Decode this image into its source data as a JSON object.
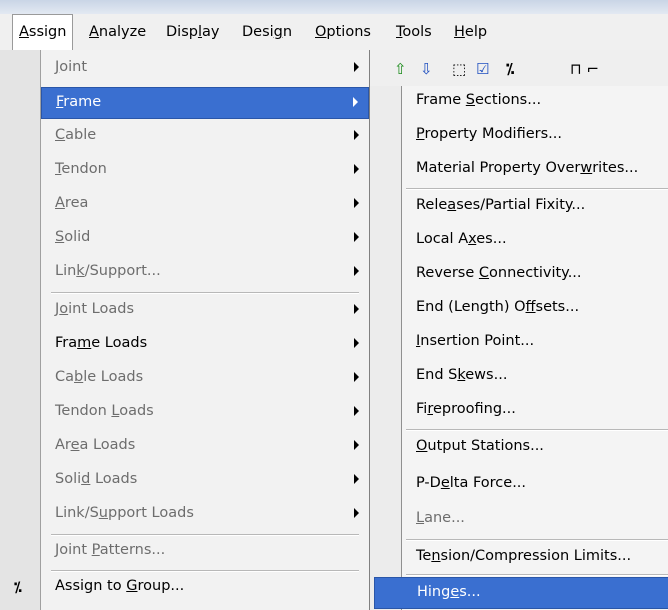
{
  "menubar": {
    "items": [
      {
        "label": "Assign",
        "mn": "A",
        "rest": "ssign"
      },
      {
        "label": "Analyze",
        "pre": "A",
        "mn": "n",
        "rest": "alyze"
      },
      {
        "label": "Display",
        "pre": "Disp",
        "mn": "l",
        "rest": "ay"
      },
      {
        "label": "Design",
        "pre": "Desi",
        "mn": "g",
        "rest": "n"
      },
      {
        "label": "Options",
        "mn": "O",
        "rest": "ptions"
      },
      {
        "label": "Tools",
        "mn": "T",
        "rest": "ools"
      },
      {
        "label": "Help",
        "mn": "H",
        "rest": "elp"
      }
    ]
  },
  "assign_menu": {
    "items": [
      {
        "label": "Joint",
        "pre": "",
        "mn": "J",
        "rest": "oint",
        "enabled": false,
        "submenu": true
      },
      {
        "label": "Frame",
        "pre": "",
        "mn": "F",
        "rest": "rame",
        "enabled": true,
        "submenu": true,
        "highlighted": true
      },
      {
        "label": "Cable",
        "pre": "",
        "mn": "C",
        "rest": "able",
        "enabled": false,
        "submenu": true
      },
      {
        "label": "Tendon",
        "pre": "",
        "mn": "T",
        "rest": "endon",
        "enabled": false,
        "submenu": true
      },
      {
        "label": "Area",
        "pre": "",
        "mn": "A",
        "rest": "rea",
        "enabled": false,
        "submenu": true
      },
      {
        "label": "Solid",
        "pre": "",
        "mn": "S",
        "rest": "olid",
        "enabled": false,
        "submenu": true
      },
      {
        "label": "Link/Support...",
        "pre": "Lin",
        "mn": "k",
        "rest": "/Support...",
        "enabled": false,
        "submenu": true
      },
      {
        "label": "Joint Loads",
        "pre": "J",
        "mn": "o",
        "rest": "int Loads",
        "enabled": false,
        "submenu": true
      },
      {
        "label": "Frame Loads",
        "pre": "Fra",
        "mn": "m",
        "rest": "e Loads",
        "enabled": true,
        "submenu": true
      },
      {
        "label": "Cable Loads",
        "pre": "Ca",
        "mn": "b",
        "rest": "le Loads",
        "enabled": false,
        "submenu": true
      },
      {
        "label": "Tendon Loads",
        "pre": "Tendon ",
        "mn": "L",
        "rest": "oads",
        "enabled": false,
        "submenu": true
      },
      {
        "label": "Area Loads",
        "pre": "Ar",
        "mn": "e",
        "rest": "a Loads",
        "enabled": false,
        "submenu": true
      },
      {
        "label": "Solid Loads",
        "pre": "Soli",
        "mn": "d",
        "rest": " Loads",
        "enabled": false,
        "submenu": true
      },
      {
        "label": "Link/Support Loads",
        "pre": "Link/S",
        "mn": "u",
        "rest": "pport Loads",
        "enabled": false,
        "submenu": true
      },
      {
        "label": "Joint Patterns...",
        "pre": "Joint ",
        "mn": "P",
        "rest": "atterns...",
        "enabled": false,
        "submenu": false
      },
      {
        "label": "Assign to Group...",
        "pre": "Assign to ",
        "mn": "G",
        "rest": "roup...",
        "enabled": true,
        "submenu": false
      }
    ]
  },
  "frame_submenu": {
    "items": [
      {
        "label": "Frame Sections...",
        "pre": "Frame ",
        "mn": "S",
        "rest": "ections...",
        "enabled": true
      },
      {
        "label": "Property Modifiers...",
        "pre": "",
        "mn": "P",
        "rest": "roperty Modifiers...",
        "enabled": true
      },
      {
        "label": "Material Property Overwrites...",
        "pre": "Material Property Over",
        "mn": "w",
        "rest": "rites...",
        "enabled": true
      },
      {
        "label": "Releases/Partial Fixity...",
        "pre": "Rele",
        "mn": "a",
        "rest": "ses/Partial Fixity...",
        "enabled": true
      },
      {
        "label": "Local Axes...",
        "pre": "Local A",
        "mn": "x",
        "rest": "es...",
        "enabled": true
      },
      {
        "label": "Reverse Connectivity...",
        "pre": "Reverse ",
        "mn": "C",
        "rest": "onnectivity...",
        "enabled": true
      },
      {
        "label": "End (Length) Offsets...",
        "pre": "End (Length) O",
        "mn": "f",
        "rest": "fsets...",
        "enabled": true
      },
      {
        "label": "Insertion Point...",
        "pre": "",
        "mn": "I",
        "rest": "nsertion Point...",
        "enabled": true
      },
      {
        "label": "End Skews...",
        "pre": "End S",
        "mn": "k",
        "rest": "ews...",
        "enabled": true
      },
      {
        "label": "Fireproofing...",
        "pre": "Fi",
        "mn": "r",
        "rest": "eproofing...",
        "enabled": true
      },
      {
        "label": "Output Stations...",
        "pre": "",
        "mn": "O",
        "rest": "utput Stations...",
        "enabled": true
      },
      {
        "label": "P-Delta Force...",
        "pre": "P-D",
        "mn": "e",
        "rest": "lta Force...",
        "enabled": true
      },
      {
        "label": "Lane...",
        "pre": "",
        "mn": "L",
        "rest": "ane...",
        "enabled": false
      },
      {
        "label": "Tension/Compression Limits...",
        "pre": "Te",
        "mn": "n",
        "rest": "sion/Compression Limits...",
        "enabled": true
      },
      {
        "label": "Hinges...",
        "pre": "Hing",
        "mn": "e",
        "rest": "s...",
        "enabled": true,
        "highlighted": true
      }
    ]
  },
  "icons": {
    "left_strip": "percent-icon",
    "toolbar": [
      "up-arrow-icon",
      "down-arrow-icon",
      "select-icon",
      "checkbox-icon",
      "percent-icon",
      "frame-icon"
    ]
  },
  "colors": {
    "highlight": "#3a6fd0",
    "menu_bg": "#f2f2f2",
    "disabled": "#6d6d6d"
  }
}
